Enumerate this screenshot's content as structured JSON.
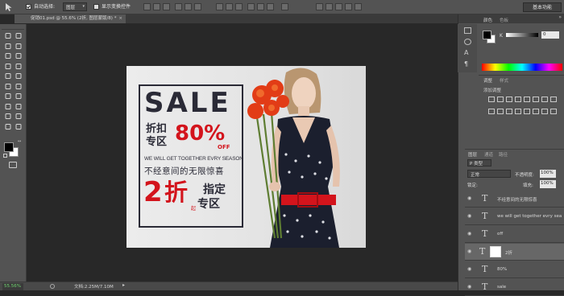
{
  "options_bar": {
    "auto_select_label": "自动选择:",
    "auto_select_value": "图层",
    "show_transform_label": "显示变换控件",
    "workspace": "基本功能"
  },
  "document_tab": {
    "title": "促销01.psd @ 55.6% (2折, 图层蒙版/8) *"
  },
  "status_bar": {
    "zoom": "55.56%",
    "doc_info": "文档:2.25M/7.10M"
  },
  "color_panel": {
    "tabs": [
      "颜色",
      "色板"
    ],
    "k_label": "K",
    "k_value": "0",
    "fg_color": "#000000",
    "bg_color": "#ffffff"
  },
  "adjust_panel": {
    "tabs": [
      "调整",
      "样式"
    ],
    "add_label": "添加调整"
  },
  "layers_panel": {
    "tabs": [
      "图层",
      "通道",
      "路径"
    ],
    "kind_filter": "P 类型",
    "blend_mode": "正常",
    "opacity_label": "不透明度:",
    "opacity_value": "100%",
    "lock_label": "锁定:",
    "fill_label": "填充:",
    "fill_value": "100%",
    "layers": [
      {
        "name": "不经意间的无限惊喜"
      },
      {
        "name": "we will get together evry sea..."
      },
      {
        "name": "off"
      },
      {
        "name": "2折"
      },
      {
        "name": "80%"
      },
      {
        "name": "sale"
      }
    ]
  },
  "ad": {
    "sale": "SALE",
    "zhekou": "折扣",
    "zhuanqu": "专区",
    "percent": "80%",
    "off": "OFF",
    "english_line": "WE WILL GET TOGETHER EVRY SEASON",
    "chinese_line": "不经意间的无限惊喜",
    "two": "2",
    "zhe": "折",
    "qi": "起",
    "zhiding": "指定",
    "zhuanqu2": "专区",
    "accent_red": "#d3141c",
    "dark_text": "#2a2a36"
  }
}
